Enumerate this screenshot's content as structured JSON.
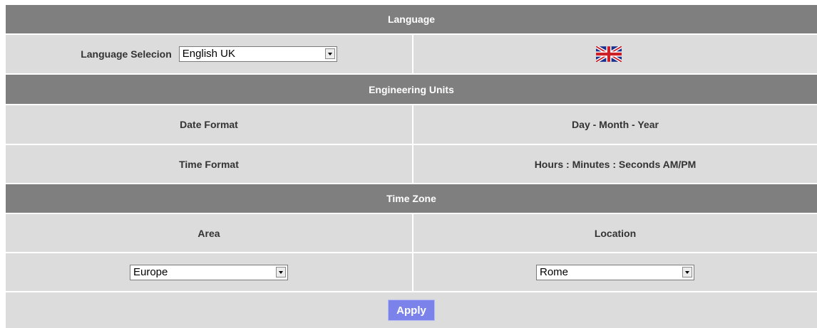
{
  "language": {
    "header": "Language",
    "selection_label": "Language Selecion",
    "selected_language": "English UK",
    "flag_icon": "uk-flag-icon"
  },
  "engineering_units": {
    "header": "Engineering Units",
    "date_format_label": "Date Format",
    "date_format_value": "Day - Month - Year",
    "time_format_label": "Time Format",
    "time_format_value": "Hours : Minutes : Seconds AM/PM"
  },
  "time_zone": {
    "header": "Time Zone",
    "area_label": "Area",
    "location_label": "Location",
    "area_value": "Europe",
    "location_value": "Rome"
  },
  "actions": {
    "apply_label": "Apply"
  },
  "colors": {
    "header_bg": "#7f7f7f",
    "row_bg": "#dcdcdc",
    "apply_bg": "#7b83ea"
  }
}
